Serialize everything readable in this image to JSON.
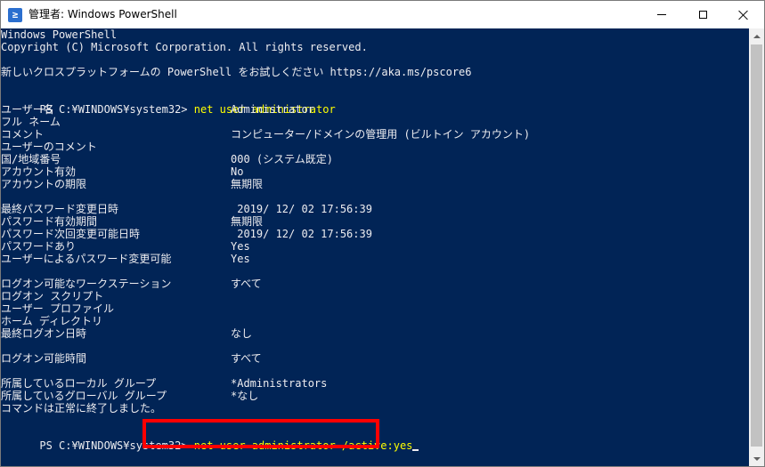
{
  "window": {
    "title": "管理者: Windows PowerShell",
    "app_icon_glyph": "≥",
    "background_color": "#012456",
    "text_color": "#eeedf0",
    "command_color": "#ffff00",
    "highlight_color": "#ff0000"
  },
  "header_lines": [
    "Windows PowerShell",
    "Copyright (C) Microsoft Corporation. All rights reserved.",
    "",
    "新しいクロスプラットフォームの PowerShell をお試しください https://aka.ms/pscore6"
  ],
  "prompt1": {
    "prompt": "PS C:¥WINDOWS¥system32> ",
    "command": "net user administrator"
  },
  "rows": [
    {
      "label": "ユーザー名",
      "value": "Administrator"
    },
    {
      "label": "フル ネーム",
      "value": ""
    },
    {
      "label": "コメント",
      "value": "コンピューター/ドメインの管理用 (ビルトイン アカウント)"
    },
    {
      "label": "ユーザーのコメント",
      "value": ""
    },
    {
      "label": "国/地域番号",
      "value": "000 (システム既定)"
    },
    {
      "label": "アカウント有効",
      "value": "No"
    },
    {
      "label": "アカウントの期限",
      "value": "無期限"
    },
    {
      "label": "",
      "value": ""
    },
    {
      "label": "最終パスワード変更日時",
      "value": " 2019/ 12/ 02 17:56:39"
    },
    {
      "label": "パスワード有効期間",
      "value": "無期限"
    },
    {
      "label": "パスワード次回変更可能日時",
      "value": " 2019/ 12/ 02 17:56:39"
    },
    {
      "label": "パスワードあり",
      "value": "Yes"
    },
    {
      "label": "ユーザーによるパスワード変更可能",
      "value": "Yes"
    },
    {
      "label": "",
      "value": ""
    },
    {
      "label": "ログオン可能なワークステーション",
      "value": "すべて"
    },
    {
      "label": "ログオン スクリプト",
      "value": ""
    },
    {
      "label": "ユーザー プロファイル",
      "value": ""
    },
    {
      "label": "ホーム ディレクトリ",
      "value": ""
    },
    {
      "label": "最終ログオン日時",
      "value": "なし"
    },
    {
      "label": "",
      "value": ""
    },
    {
      "label": "ログオン可能時間",
      "value": "すべて"
    },
    {
      "label": "",
      "value": ""
    },
    {
      "label": "所属しているローカル グループ",
      "value": "*Administrators"
    },
    {
      "label": "所属しているグローバル グループ",
      "value": "*なし"
    },
    {
      "label": "コマンドは正常に終了しました。",
      "value": ""
    }
  ],
  "prompt2": {
    "prompt": "PS C:¥WINDOWS¥system32> ",
    "command": "net user administrator /active:yes"
  }
}
